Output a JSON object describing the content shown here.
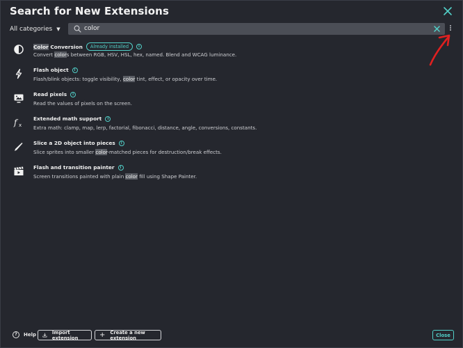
{
  "dialog": {
    "title": "Search for New Extensions"
  },
  "filter": {
    "category": "All categories"
  },
  "search": {
    "query": "color"
  },
  "extensions": [
    {
      "icon": "contrast-icon",
      "name_parts": [
        {
          "t": "Color",
          "h": true
        },
        {
          "t": " Conversion",
          "h": false
        }
      ],
      "badge": "Already installed",
      "desc_parts": [
        {
          "t": "Convert ",
          "h": false
        },
        {
          "t": "color",
          "h": true
        },
        {
          "t": "s between RGB, HSV, HSL, hex, named. Blend and WCAG luminance.",
          "h": false
        }
      ]
    },
    {
      "icon": "lightning-icon",
      "name_parts": [
        {
          "t": "Flash object",
          "h": false
        }
      ],
      "badge": "",
      "desc_parts": [
        {
          "t": "Flash/blink objects: toggle visibility, ",
          "h": false
        },
        {
          "t": "color",
          "h": true
        },
        {
          "t": " tint, effect, or opacity over time.",
          "h": false
        }
      ]
    },
    {
      "icon": "screen-pixels-icon",
      "name_parts": [
        {
          "t": "Read pixels",
          "h": false
        }
      ],
      "badge": "",
      "desc_parts": [
        {
          "t": "Read the values of pixels on the screen.",
          "h": false
        }
      ]
    },
    {
      "icon": "function-icon",
      "name_parts": [
        {
          "t": "Extended math support",
          "h": false
        }
      ],
      "badge": "",
      "desc_parts": [
        {
          "t": "Extra math: clamp, map, lerp, factorial, fibonacci, distance, angle, conversions, constants.",
          "h": false
        }
      ]
    },
    {
      "icon": "blade-icon",
      "name_parts": [
        {
          "t": "Slice a 2D object into pieces",
          "h": false
        }
      ],
      "badge": "",
      "desc_parts": [
        {
          "t": "Slice sprites into smaller ",
          "h": false
        },
        {
          "t": "color",
          "h": true
        },
        {
          "t": "-matched pieces for destruction/break effects.",
          "h": false
        }
      ]
    },
    {
      "icon": "clapperboard-icon",
      "name_parts": [
        {
          "t": "Flash and transition painter",
          "h": false
        }
      ],
      "badge": "",
      "desc_parts": [
        {
          "t": "Screen transitions painted with plain ",
          "h": false
        },
        {
          "t": "color",
          "h": true
        },
        {
          "t": " fill using Shape Painter.",
          "h": false
        }
      ]
    }
  ],
  "footer": {
    "help": "Help",
    "import": "Import extension",
    "create": "Create a new extension",
    "close": "Close"
  },
  "colors": {
    "accent": "#52d1c9",
    "background": "#25272e",
    "annotation": "#e02020"
  }
}
